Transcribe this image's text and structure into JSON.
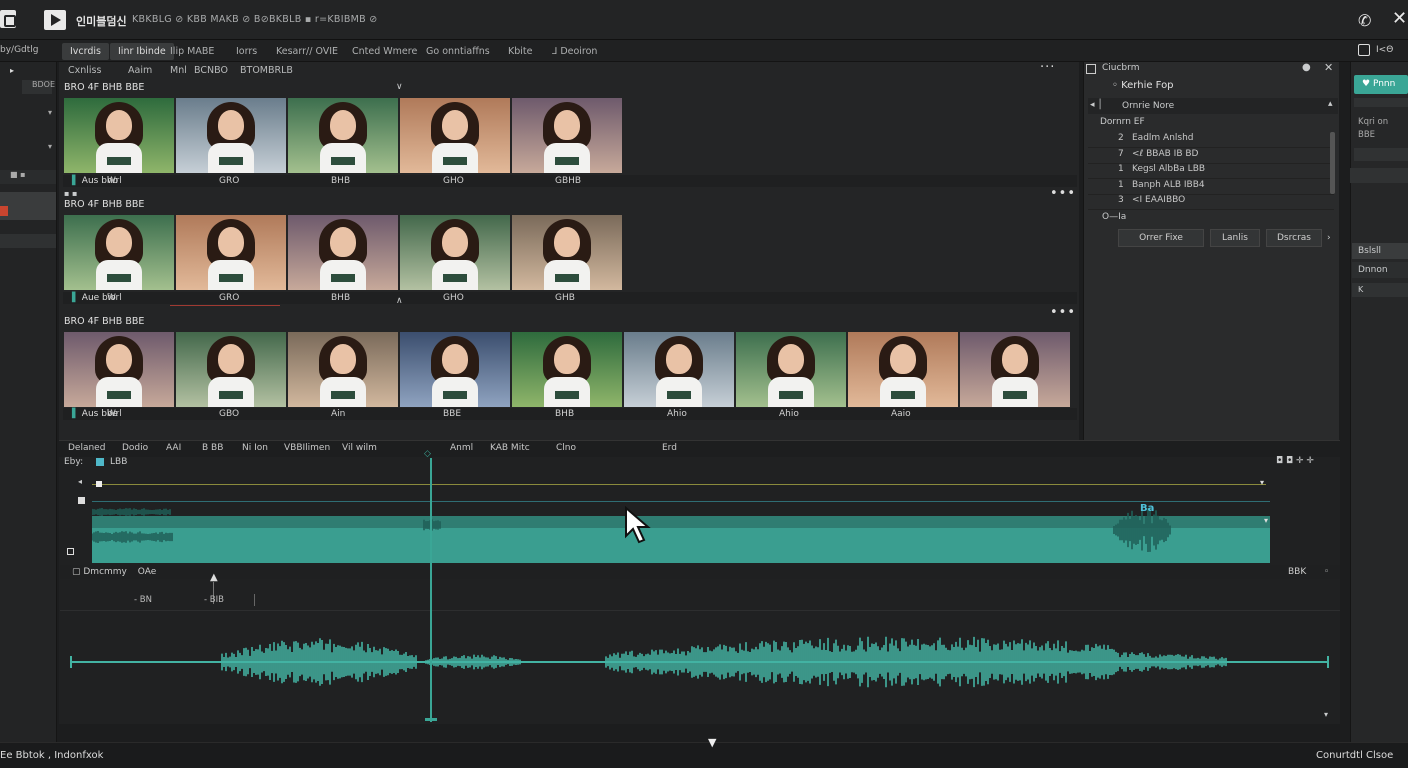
{
  "titlebar": {
    "title": "인미블덤신",
    "menu": "KBKBLG ⊘ KBB MAKB ⊘ B⊘BKBLB ▪ r=KBIBMB ⊘",
    "phone_icon": "phone-icon",
    "close_icon": "close-icon"
  },
  "tabs": [
    "Ivcrdis",
    "Iinr Ibinde",
    "Ilip MABE",
    "Iorrs",
    "Kesarr// OVIE",
    "Cnted Wmere",
    "Go onntiaffns",
    "Kbite",
    "⅃ Deoiron"
  ],
  "left_sidebar": {
    "title": "by/Gdtlg",
    "dropdown": "BDOE"
  },
  "media": {
    "subtabs": [
      "Cxnliss",
      "Aaim",
      "Mnl",
      "BCNBO",
      "BTOMBRLB"
    ],
    "strips": [
      {
        "label": "BRO  4F BHB BBE",
        "footer": "Aus bho",
        "captions": [
          "Wrl",
          "GRO",
          "BHB",
          "GHO",
          "GBHB"
        ]
      },
      {
        "label": "BRO  4F BHB BBE",
        "footer": "Aue bio",
        "captions": [
          "Wrl",
          "GRO",
          "BHB",
          "GHO",
          "GHB"
        ]
      },
      {
        "label": "BRO  4F BHB BBE",
        "footer": "Aus bbe",
        "captions": [
          "Wrl",
          "GBO",
          "Ain",
          "BBE",
          "BHB",
          "Ahio",
          "Ahio",
          "Aaio"
        ]
      }
    ]
  },
  "right_panel": {
    "header": "Ciucbrm",
    "subheader": "Kerhie Fop",
    "group": "Ornrie Nore",
    "section": "Dornrn EF",
    "rows": [
      {
        "n": "2",
        "t": "Eadlm Anlshd"
      },
      {
        "n": "7",
        "t": "<ℓ BBAB IB BD"
      },
      {
        "n": "1",
        "t": "Kegsl AlbBa LBB"
      },
      {
        "n": "1",
        "t": "Banph ALB IBB4"
      },
      {
        "n": "3",
        "t": "<I EAAIBBO"
      }
    ],
    "footer_label": "O—Ia",
    "buttons": [
      "Orrer Fixe",
      "Lanlis",
      "Dsrcras"
    ]
  },
  "far_right": {
    "accent_btn": "Pnnn",
    "text1": "Kqri on",
    "text2": "BBE",
    "label1": "Bslsll",
    "label2": "Dnnon",
    "label3": "K"
  },
  "timeline": {
    "toolbar": [
      "Delaned",
      "Dodio",
      "AAI",
      "B BB",
      "Ni Ion",
      "VBBIlimen",
      "Vil wilm",
      "Anml",
      "KAB Mitc",
      "Clno",
      "Erd"
    ],
    "track_label": "Eby:",
    "clip_label": "LBB",
    "marker_label": "Ba",
    "zoom_label": "BBK",
    "mid_label": "Dmcmmy",
    "mid_label2": "OAe",
    "ruler": [
      "- BN",
      "- BIB"
    ]
  },
  "status": {
    "left": "Ee Bbtok , Indonfxok",
    "right": "Conurtdtl Clsoe"
  },
  "colors": {
    "accent": "#3aa696",
    "waveform": "#43b3a3"
  }
}
